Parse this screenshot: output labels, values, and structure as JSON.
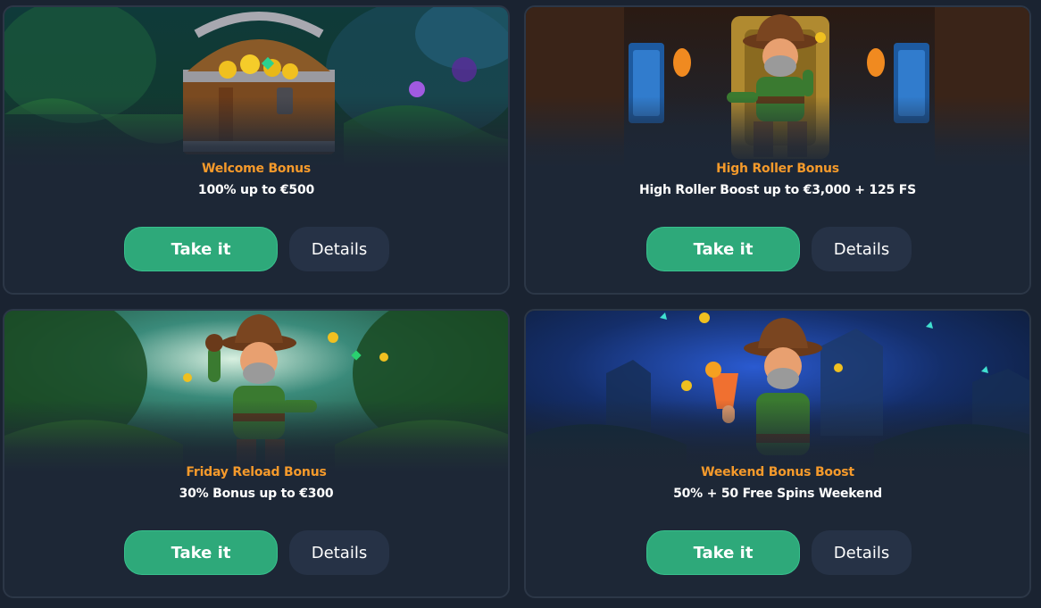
{
  "bonuses": [
    {
      "title": "Welcome Bonus",
      "description": "100% up to €500",
      "take_label": "Take it",
      "details_label": "Details",
      "image_icon": "treasure-chest"
    },
    {
      "title": "High Roller Bonus",
      "description": "High Roller Boost up to €3,000 + 125 FS",
      "take_label": "Take it",
      "details_label": "Details",
      "image_icon": "explorer-on-throne"
    },
    {
      "title": "Friday Reload Bonus",
      "description": "30% Bonus up to €300",
      "take_label": "Take it",
      "details_label": "Details",
      "image_icon": "explorer-cheering"
    },
    {
      "title": "Weekend Bonus Boost",
      "description": "50% + 50 Free Spins Weekend",
      "take_label": "Take it",
      "details_label": "Details",
      "image_icon": "explorer-cocktail"
    }
  ],
  "colors": {
    "background": "#1a2331",
    "card": "#1d2736",
    "title": "#f59a2b",
    "take_button": "#2ea97a",
    "details_button": "#263246"
  }
}
